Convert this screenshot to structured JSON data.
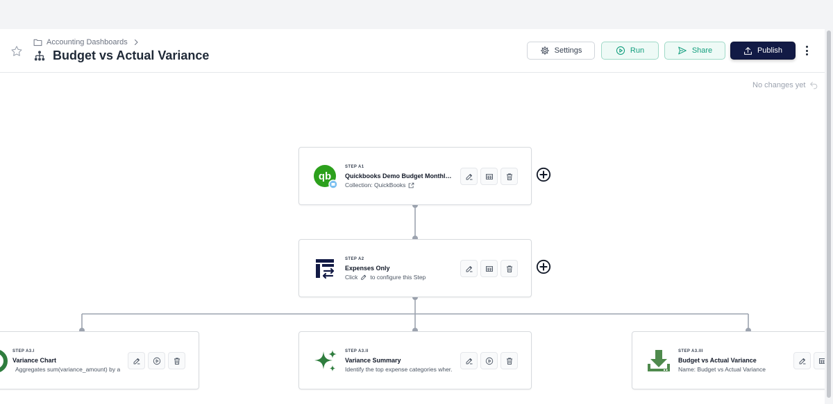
{
  "header": {
    "breadcrumb": "Accounting Dashboards",
    "title": "Budget vs Actual Variance",
    "buttons": {
      "settings": "Settings",
      "run": "Run",
      "share": "Share",
      "publish": "Publish"
    }
  },
  "status": {
    "no_changes": "No changes yet"
  },
  "steps": {
    "a1": {
      "label": "STEP A1",
      "title": "Quickbooks Demo Budget Monthly ...",
      "subtitle": "Collection: QuickBooks"
    },
    "a2": {
      "label": "STEP A2",
      "title": "Expenses Only",
      "subtitle_pre": "Click",
      "subtitle_post": "to configure this Step"
    },
    "a3i": {
      "label": "STEP A3.I",
      "title": "Variance Chart",
      "subtitle": "Aggregates sum(variance_amount) by accou..."
    },
    "a3ii": {
      "label": "STEP A3.II",
      "title": "Variance Summary",
      "subtitle": "Identify the top expense categories wher..."
    },
    "a3iii": {
      "label": "STEP A3.III",
      "title": "Budget vs Actual Variance",
      "subtitle": "Name: Budget vs Actual Variance"
    }
  },
  "colors": {
    "accent_dark": "#121a45",
    "accent_green": "#129e7d",
    "quickbooks_green": "#2ca01c",
    "export_green": "#4f8a4d",
    "connector": "#9ca3af"
  },
  "icons": [
    "star-icon",
    "folder-icon",
    "chevron-right-icon",
    "workflow-icon",
    "gear-icon",
    "play-icon",
    "share-icon",
    "upload-icon",
    "more-icon",
    "undo-icon",
    "quickbooks-logo-icon",
    "filter-table-icon",
    "sparkle-icon",
    "download-icon",
    "edit-icon",
    "table-icon",
    "trash-icon",
    "plus-circle-icon",
    "external-link-icon",
    "chart-icon"
  ]
}
